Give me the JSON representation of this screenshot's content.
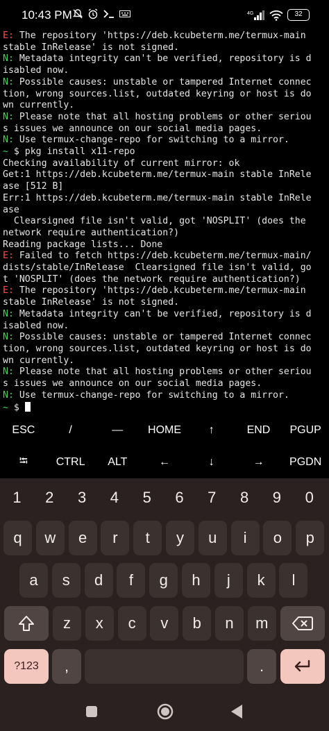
{
  "status": {
    "time": "10:43 PM",
    "battery": "32"
  },
  "terminal": {
    "lines": [
      [
        {
          "t": "E:",
          "c": "e"
        },
        {
          "t": " The repository 'https://deb.kcubeterm.me/termux-main"
        }
      ],
      [
        {
          "t": "stable InRelease' is not signed."
        }
      ],
      [
        {
          "t": "N:",
          "c": "n"
        },
        {
          "t": " Metadata integrity can't be verified, repository is d"
        }
      ],
      [
        {
          "t": "isabled now."
        }
      ],
      [
        {
          "t": "N:",
          "c": "n"
        },
        {
          "t": " Possible causes: unstable or tampered Internet connec"
        }
      ],
      [
        {
          "t": "tion, wrong sources.list, outdated keyring or host is do"
        }
      ],
      [
        {
          "t": "wn currently."
        }
      ],
      [
        {
          "t": "N:",
          "c": "n"
        },
        {
          "t": " Please note that all hosting problems or other seriou"
        }
      ],
      [
        {
          "t": "s issues we announce on our social media pages."
        }
      ],
      [
        {
          "t": "N:",
          "c": "n"
        },
        {
          "t": " Use termux-change-repo for switching to a mirror."
        }
      ],
      [
        {
          "t": "~",
          "c": "p"
        },
        {
          "t": " $ pkg install x11-repo"
        }
      ],
      [
        {
          "t": "Checking availability of current mirror: ok"
        }
      ],
      [
        {
          "t": "Get:1 https://deb.kcubeterm.me/termux-main stable InRele"
        }
      ],
      [
        {
          "t": "ase [512 B]"
        }
      ],
      [
        {
          "t": "Err:1 https://deb.kcubeterm.me/termux-main stable InRele"
        }
      ],
      [
        {
          "t": "ase"
        }
      ],
      [
        {
          "t": "  Clearsigned file isn't valid, got 'NOSPLIT' (does the"
        }
      ],
      [
        {
          "t": "network require authentication?)"
        }
      ],
      [
        {
          "t": "Reading package lists... Done"
        }
      ],
      [
        {
          "t": "E:",
          "c": "e"
        },
        {
          "t": " Failed to fetch https://deb.kcubeterm.me/termux-main/"
        }
      ],
      [
        {
          "t": "dists/stable/InRelease  Clearsigned file isn't valid, go"
        }
      ],
      [
        {
          "t": "t 'NOSPLIT' (does the network require authentication?)"
        }
      ],
      [
        {
          "t": "E:",
          "c": "e"
        },
        {
          "t": " The repository 'https://deb.kcubeterm.me/termux-main"
        }
      ],
      [
        {
          "t": "stable InRelease' is not signed."
        }
      ],
      [
        {
          "t": "N:",
          "c": "n"
        },
        {
          "t": " Metadata integrity can't be verified, repository is d"
        }
      ],
      [
        {
          "t": "isabled now."
        }
      ],
      [
        {
          "t": "N:",
          "c": "n"
        },
        {
          "t": " Possible causes: unstable or tampered Internet connec"
        }
      ],
      [
        {
          "t": "tion, wrong sources.list, outdated keyring or host is do"
        }
      ],
      [
        {
          "t": "wn currently."
        }
      ],
      [
        {
          "t": "N:",
          "c": "n"
        },
        {
          "t": " Please note that all hosting problems or other seriou"
        }
      ],
      [
        {
          "t": "s issues we announce on our social media pages."
        }
      ],
      [
        {
          "t": "N:",
          "c": "n"
        },
        {
          "t": " Use termux-change-repo for switching to a mirror."
        }
      ]
    ],
    "prompt_symbol": "~",
    "prompt_dollar": " $ "
  },
  "extra_keys": {
    "row1": [
      "ESC",
      "/",
      "—",
      "HOME",
      "↑",
      "END",
      "PGUP"
    ],
    "row2": [
      "⭾",
      "CTRL",
      "ALT",
      "←",
      "↓",
      "→",
      "PGDN"
    ]
  },
  "keyboard": {
    "numbers": [
      "1",
      "2",
      "3",
      "4",
      "5",
      "6",
      "7",
      "8",
      "9",
      "0"
    ],
    "row1": [
      "q",
      "w",
      "e",
      "r",
      "t",
      "y",
      "u",
      "i",
      "o",
      "p"
    ],
    "row2": [
      "a",
      "s",
      "d",
      "f",
      "g",
      "h",
      "j",
      "k",
      "l"
    ],
    "row3": [
      "z",
      "x",
      "c",
      "v",
      "b",
      "n",
      "m"
    ],
    "symbols_key": "?123",
    "comma_key": ",",
    "period_key": "."
  },
  "colors": {
    "error_prefix": "#ff4a4a",
    "notice_prefix": "#4ad35a",
    "keyboard_bg": "#2a2120",
    "key_bg": "#3b3230",
    "accent_key": "#f3c6be"
  }
}
